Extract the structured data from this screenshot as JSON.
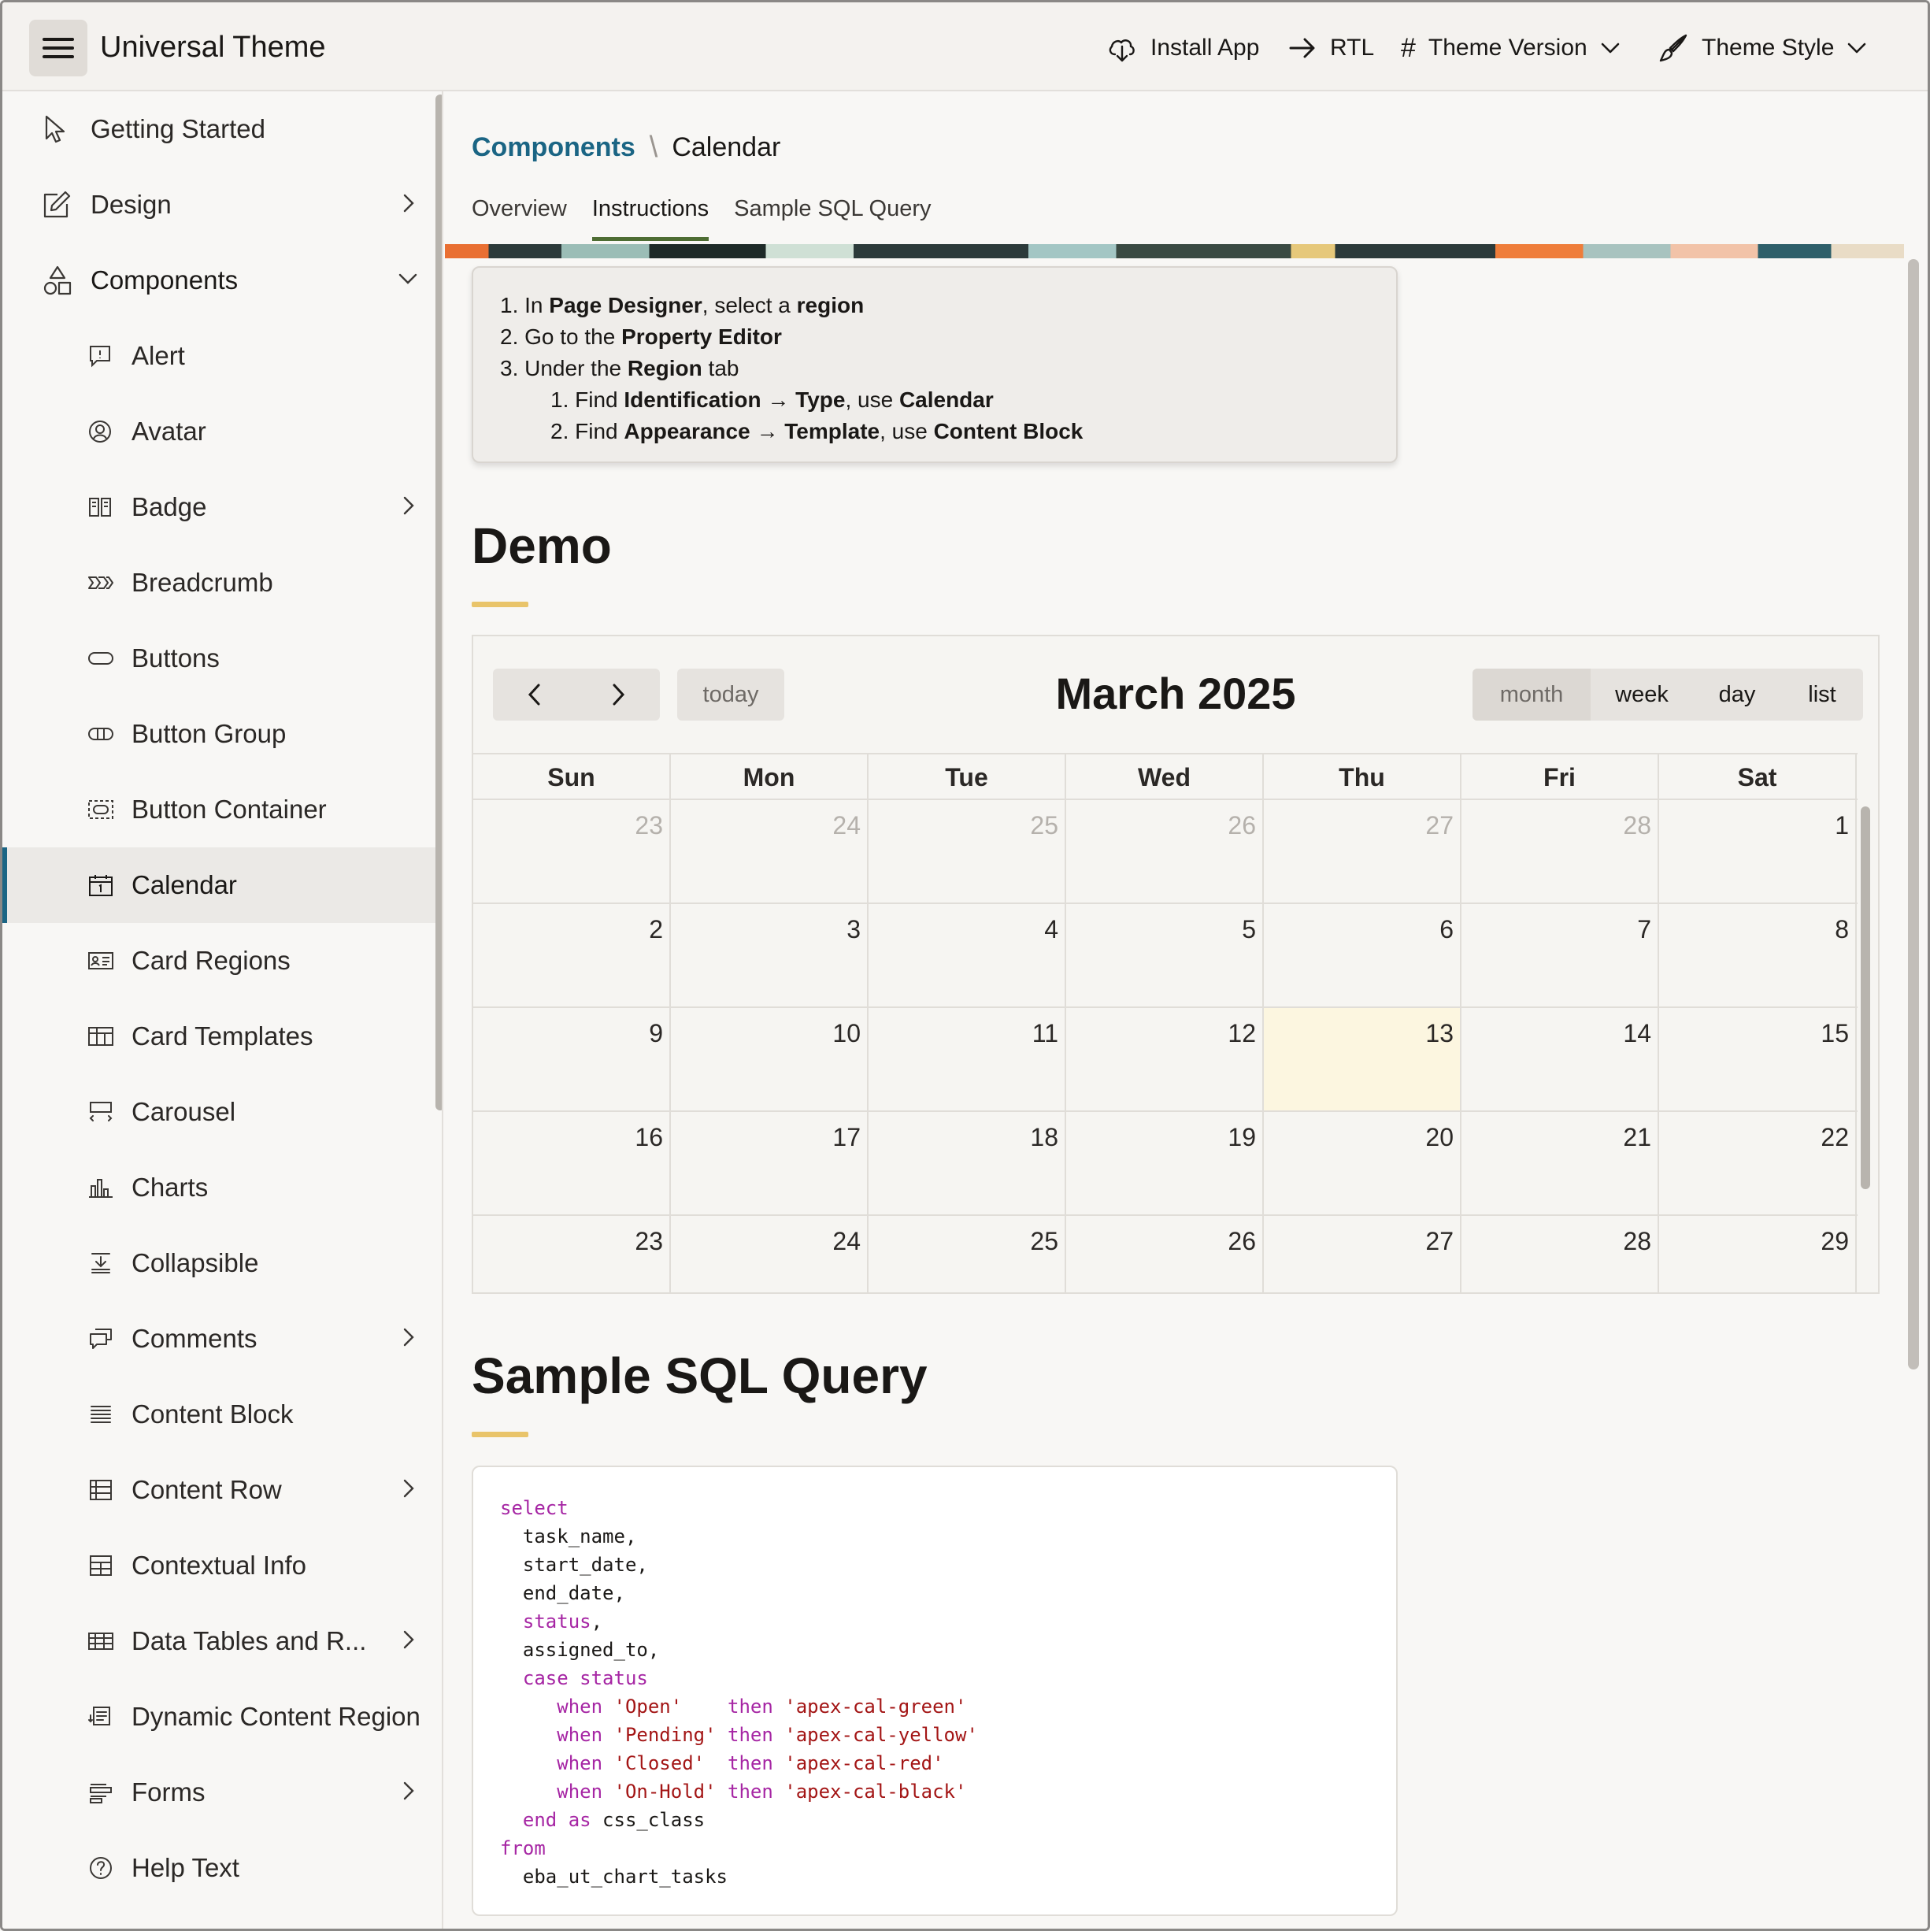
{
  "header": {
    "app_title": "Universal Theme",
    "install_label": "Install App",
    "rtl_label": "RTL",
    "version_label": "Theme Version",
    "style_label": "Theme Style"
  },
  "sidebar": {
    "items": [
      {
        "label": "Getting Started",
        "icon": "cursor-pointer-icon"
      },
      {
        "label": "Design",
        "icon": "pencil-square-icon",
        "chevron": "right"
      },
      {
        "label": "Components",
        "icon": "shapes-icon",
        "chevron": "down"
      },
      {
        "label": "Alert",
        "icon": "chat-alert-icon"
      },
      {
        "label": "Avatar",
        "icon": "user-circle-icon"
      },
      {
        "label": "Badge",
        "icon": "badge-icon",
        "chevron": "right"
      },
      {
        "label": "Breadcrumb",
        "icon": "breadcrumb-icon"
      },
      {
        "label": "Buttons",
        "icon": "button-pill-icon"
      },
      {
        "label": "Button Group",
        "icon": "button-group-icon"
      },
      {
        "label": "Button Container",
        "icon": "button-container-icon"
      },
      {
        "label": "Calendar",
        "icon": "calendar-icon",
        "active": true
      },
      {
        "label": "Card Regions",
        "icon": "id-card-icon"
      },
      {
        "label": "Card Templates",
        "icon": "card-grid-icon"
      },
      {
        "label": "Carousel",
        "icon": "carousel-icon"
      },
      {
        "label": "Charts",
        "icon": "bar-chart-icon"
      },
      {
        "label": "Collapsible",
        "icon": "collapse-icon"
      },
      {
        "label": "Comments",
        "icon": "comments-icon",
        "chevron": "right"
      },
      {
        "label": "Content Block",
        "icon": "content-lines-icon"
      },
      {
        "label": "Content Row",
        "icon": "content-row-icon",
        "chevron": "right"
      },
      {
        "label": "Contextual Info",
        "icon": "contextual-info-icon"
      },
      {
        "label": "Data Tables and R...",
        "icon": "table-icon",
        "chevron": "right"
      },
      {
        "label": "Dynamic Content Region",
        "icon": "dynamic-content-icon"
      },
      {
        "label": "Forms",
        "icon": "form-icon",
        "chevron": "right"
      },
      {
        "label": "Help Text",
        "icon": "help-circle-icon"
      }
    ]
  },
  "breadcrumb": {
    "parent": "Components",
    "separator": "\\",
    "current": "Calendar"
  },
  "tabs": [
    {
      "label": "Overview"
    },
    {
      "label": "Instructions",
      "active": true
    },
    {
      "label": "Sample SQL Query"
    }
  ],
  "instructions": {
    "l1_pre": "1. In ",
    "l1_b1": "Page Designer",
    "l1_mid": ", select a ",
    "l1_b2": "region",
    "l2_pre": "2. Go to the ",
    "l2_b1": "Property Editor",
    "l3_pre": "3. Under the ",
    "l3_b1": "Region",
    "l3_post": " tab",
    "l4_pre": "1. Find ",
    "l4_b1": "Identification → Type",
    "l4_mid": ", use ",
    "l4_b2": "Calendar",
    "l5_pre": "2. Find ",
    "l5_b1": "Appearance → Template",
    "l5_mid": ", use ",
    "l5_b2": "Content Block"
  },
  "demo": {
    "heading": "Demo"
  },
  "calendar": {
    "title": "March 2025",
    "today_label": "today",
    "views": [
      "month",
      "week",
      "day",
      "list"
    ],
    "active_view": "month",
    "weekdays": [
      "Sun",
      "Mon",
      "Tue",
      "Wed",
      "Thu",
      "Fri",
      "Sat"
    ],
    "weeks": [
      [
        "23",
        "24",
        "25",
        "26",
        "27",
        "28",
        "1"
      ],
      [
        "2",
        "3",
        "4",
        "5",
        "6",
        "7",
        "8"
      ],
      [
        "9",
        "10",
        "11",
        "12",
        "13",
        "14",
        "15"
      ],
      [
        "16",
        "17",
        "18",
        "19",
        "20",
        "21",
        "22"
      ],
      [
        "23",
        "24",
        "25",
        "26",
        "27",
        "28",
        "29"
      ]
    ],
    "today_date": "13"
  },
  "sql": {
    "heading": "Sample SQL Query",
    "lines": [
      [
        {
          "t": "select",
          "c": "kw"
        }
      ],
      [
        {
          "t": "  task_name,",
          "c": ""
        }
      ],
      [
        {
          "t": "  start_date,",
          "c": ""
        }
      ],
      [
        {
          "t": "  end_date,",
          "c": ""
        }
      ],
      [
        {
          "t": "  ",
          "c": ""
        },
        {
          "t": "status",
          "c": "kw"
        },
        {
          "t": ",",
          "c": ""
        }
      ],
      [
        {
          "t": "  assigned_to,",
          "c": ""
        }
      ],
      [
        {
          "t": "  ",
          "c": ""
        },
        {
          "t": "case status",
          "c": "kw"
        }
      ],
      [
        {
          "t": "     ",
          "c": ""
        },
        {
          "t": "when",
          "c": "kw"
        },
        {
          "t": " ",
          "c": ""
        },
        {
          "t": "'Open'",
          "c": "str"
        },
        {
          "t": "    ",
          "c": ""
        },
        {
          "t": "then",
          "c": "kw"
        },
        {
          "t": " ",
          "c": ""
        },
        {
          "t": "'apex-cal-green'",
          "c": "str"
        }
      ],
      [
        {
          "t": "     ",
          "c": ""
        },
        {
          "t": "when",
          "c": "kw"
        },
        {
          "t": " ",
          "c": ""
        },
        {
          "t": "'Pending'",
          "c": "str"
        },
        {
          "t": " ",
          "c": ""
        },
        {
          "t": "then",
          "c": "kw"
        },
        {
          "t": " ",
          "c": ""
        },
        {
          "t": "'apex-cal-yellow'",
          "c": "str"
        }
      ],
      [
        {
          "t": "     ",
          "c": ""
        },
        {
          "t": "when",
          "c": "kw"
        },
        {
          "t": " ",
          "c": ""
        },
        {
          "t": "'Closed'",
          "c": "str"
        },
        {
          "t": "  ",
          "c": ""
        },
        {
          "t": "then",
          "c": "kw"
        },
        {
          "t": " ",
          "c": ""
        },
        {
          "t": "'apex-cal-red'",
          "c": "str"
        }
      ],
      [
        {
          "t": "     ",
          "c": ""
        },
        {
          "t": "when",
          "c": "kw"
        },
        {
          "t": " ",
          "c": ""
        },
        {
          "t": "'On-Hold'",
          "c": "str"
        },
        {
          "t": " ",
          "c": ""
        },
        {
          "t": "then",
          "c": "kw"
        },
        {
          "t": " ",
          "c": ""
        },
        {
          "t": "'apex-cal-black'",
          "c": "str"
        }
      ],
      [
        {
          "t": "  ",
          "c": ""
        },
        {
          "t": "end as",
          "c": "kw"
        },
        {
          "t": " css_class",
          "c": ""
        }
      ],
      [
        {
          "t": "from",
          "c": "kw"
        }
      ],
      [
        {
          "t": "  eba_ut_chart_tasks",
          "c": ""
        }
      ]
    ]
  },
  "colors": {
    "accent": "#1b6584",
    "underline": "#e9c46a",
    "today_bg": "#fcf6e0",
    "keyword": "#a626a4",
    "string": "#a31515"
  }
}
